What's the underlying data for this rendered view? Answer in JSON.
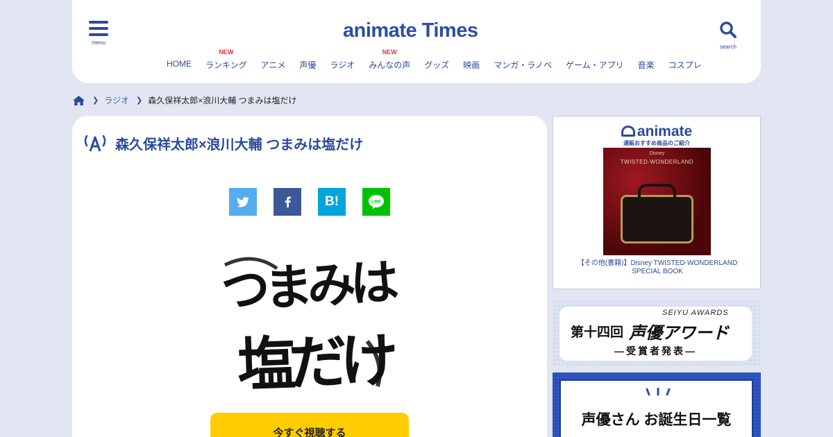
{
  "header": {
    "menu_label": "menu",
    "logo": "animate Times",
    "search_label": "search",
    "nav": [
      {
        "label": "HOME",
        "badge": ""
      },
      {
        "label": "ランキング",
        "badge": "NEW"
      },
      {
        "label": "アニメ",
        "badge": ""
      },
      {
        "label": "声優",
        "badge": ""
      },
      {
        "label": "ラジオ",
        "badge": ""
      },
      {
        "label": "みんなの声",
        "badge": "NEW"
      },
      {
        "label": "グッズ",
        "badge": ""
      },
      {
        "label": "映画",
        "badge": ""
      },
      {
        "label": "マンガ・ラノベ",
        "badge": ""
      },
      {
        "label": "ゲーム・アプリ",
        "badge": ""
      },
      {
        "label": "音楽",
        "badge": ""
      },
      {
        "label": "コスプレ",
        "badge": ""
      }
    ]
  },
  "breadcrumb": {
    "items": [
      "ラジオ",
      "森久保祥太郎×浪川大輔 つまみは塩だけ"
    ]
  },
  "article": {
    "title": "森久保祥太郎×浪川大輔 つまみは塩だけ",
    "share": [
      "twitter-icon",
      "facebook-icon",
      "hatena-icon",
      "line-icon"
    ],
    "share_hatena": "B!",
    "share_line": "LINE",
    "calligraphy_line1": "つまみは",
    "calligraphy_line2": "塩だけ",
    "watch_button": "今すぐ視聴する"
  },
  "sidebar": {
    "ad1": {
      "brand": "animate",
      "tagline": "通販おすすめ商品のご紹介",
      "product_brand": "Disney",
      "product_title": "TWISTED-WONDERLAND",
      "caption": "【その他(書籍)】Disney TWISTED-WONDERLAND SPECIAL BOOK"
    },
    "ad2": {
      "script": "SEIYU AWARDS",
      "number": "第十四回",
      "title": "声優アワード",
      "subtitle": "—受賞者発表—"
    },
    "ad3": {
      "title": "声優さん お誕生日一覧"
    }
  },
  "colors": {
    "accent": "#2a4a9c",
    "new_badge": "#e2323f",
    "page_bg": "#e2e6f2",
    "watch_button": "#ffcc00",
    "twitter": "#55acee",
    "facebook": "#3b5998",
    "hatena": "#00a4de",
    "line": "#00c300"
  }
}
